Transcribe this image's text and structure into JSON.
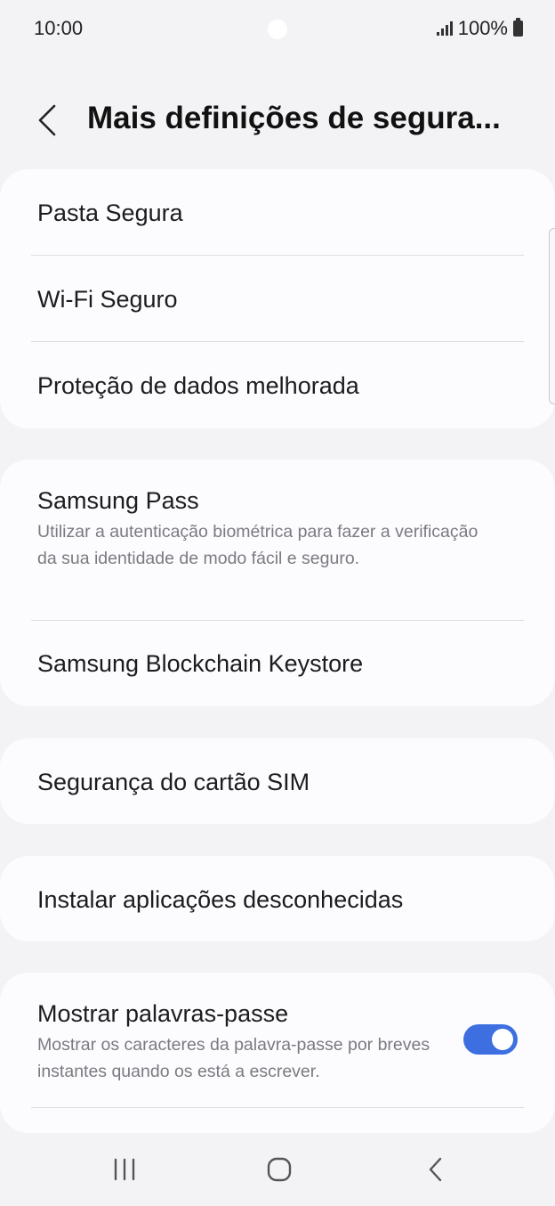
{
  "status_bar": {
    "time": "10:00",
    "battery": "100%"
  },
  "header": {
    "title": "Mais definições de segura..."
  },
  "sections": {
    "card1": {
      "items": [
        {
          "title": "Pasta Segura"
        },
        {
          "title": "Wi-Fi Seguro"
        },
        {
          "title": "Proteção de dados melhorada"
        }
      ]
    },
    "card2": {
      "items": [
        {
          "title": "Samsung Pass",
          "subtitle": "Utilizar a autenticação biométrica para fazer a verificação da sua identidade de modo fácil e seguro."
        },
        {
          "title": "Samsung Blockchain Keystore"
        }
      ]
    },
    "card3": {
      "items": [
        {
          "title": "Segurança do cartão SIM"
        }
      ]
    },
    "card4": {
      "items": [
        {
          "title": "Instalar aplicações desconhecidas"
        }
      ]
    },
    "card5": {
      "items": [
        {
          "title": "Mostrar palavras-passe",
          "subtitle": "Mostrar os caracteres da palavra-passe por breves instantes quando os está a escrever.",
          "toggle_on": true
        }
      ]
    }
  },
  "icons": {
    "back": "chevron-left-icon",
    "nav_recents": "recents-icon",
    "nav_home": "home-icon",
    "nav_back": "back-icon",
    "signal": "signal-icon",
    "battery": "battery-icon"
  },
  "colors": {
    "background": "#f3f3f6",
    "card": "#fcfcff",
    "toggle_on": "#3d6fe0",
    "subtitle": "#7a7a80"
  }
}
